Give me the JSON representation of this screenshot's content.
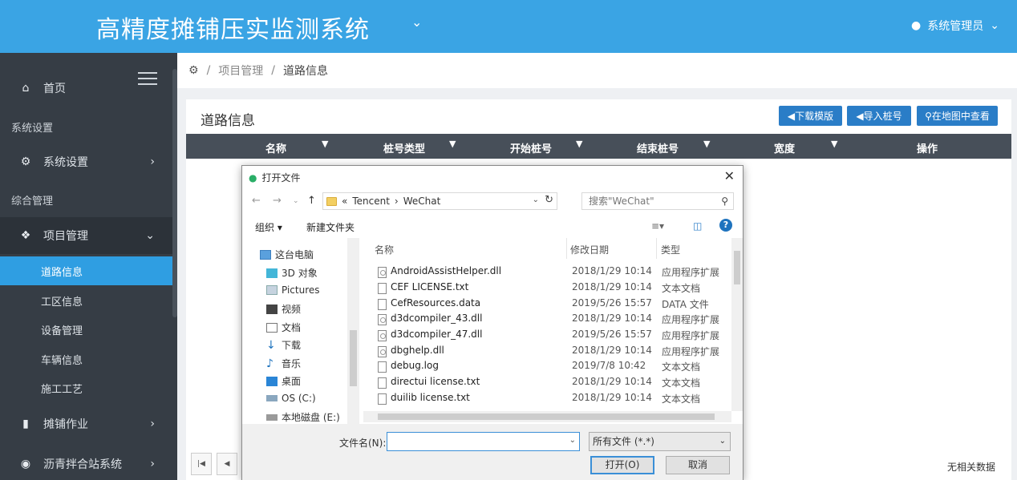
{
  "header": {
    "app_title": "高精度摊铺压实监测系统",
    "user_name": "系统管理员",
    "user_icon": "person-icon",
    "accent": "#3aa4e4"
  },
  "sidebar": {
    "home": "首页",
    "section_system": "系统设置",
    "system_settings": "系统设置",
    "section_general": "综合管理",
    "project_mgmt": "项目管理",
    "sub_items": [
      "道路信息",
      "工区信息",
      "设备管理",
      "车辆信息",
      "施工工艺"
    ],
    "active_sub": "道路信息",
    "paving": "摊铺作业",
    "asphalt": "沥青拌合站系统"
  },
  "breadcrumb": {
    "items": [
      "项目管理",
      "道路信息"
    ]
  },
  "panel": {
    "title": "道路信息",
    "btn_download": "下载模版",
    "btn_import": "导入桩号",
    "btn_map": "在地图中查看",
    "columns": [
      "名称",
      "桩号类型",
      "开始桩号",
      "结束桩号",
      "宽度",
      "操作"
    ],
    "no_data": "无相关数据"
  },
  "dialog": {
    "title": "打开文件",
    "path": [
      "«",
      "Tencent",
      "›",
      "WeChat"
    ],
    "search_placeholder": "搜索\"WeChat\"",
    "organize": "组织 ▾",
    "new_folder": "新建文件夹",
    "nav_items": [
      {
        "label": "这台电脑",
        "icon": "computer-icon"
      },
      {
        "label": "3D 对象",
        "icon": "cube-icon"
      },
      {
        "label": "Pictures",
        "icon": "pictures-icon"
      },
      {
        "label": "视频",
        "icon": "video-icon"
      },
      {
        "label": "文档",
        "icon": "document-icon"
      },
      {
        "label": "下载",
        "icon": "download-icon"
      },
      {
        "label": "音乐",
        "icon": "music-icon"
      },
      {
        "label": "桌面",
        "icon": "desktop-icon"
      },
      {
        "label": "OS (C:)",
        "icon": "drive-icon"
      },
      {
        "label": "本地磁盘 (E:)",
        "icon": "drive-icon"
      }
    ],
    "col_name": "名称",
    "col_date": "修改日期",
    "col_type": "类型",
    "files": [
      {
        "name": "AndroidAssistHelper.dll",
        "date": "2018/1/29 10:14",
        "type": "应用程序扩展",
        "kind": "dll"
      },
      {
        "name": "CEF LICENSE.txt",
        "date": "2018/1/29 10:14",
        "type": "文本文档",
        "kind": "txt"
      },
      {
        "name": "CefResources.data",
        "date": "2019/5/26 15:57",
        "type": "DATA 文件",
        "kind": "file"
      },
      {
        "name": "d3dcompiler_43.dll",
        "date": "2018/1/29 10:14",
        "type": "应用程序扩展",
        "kind": "dll"
      },
      {
        "name": "d3dcompiler_47.dll",
        "date": "2019/5/26 15:57",
        "type": "应用程序扩展",
        "kind": "dll"
      },
      {
        "name": "dbghelp.dll",
        "date": "2018/1/29 10:14",
        "type": "应用程序扩展",
        "kind": "dll"
      },
      {
        "name": "debug.log",
        "date": "2019/7/8 10:42",
        "type": "文本文档",
        "kind": "txt"
      },
      {
        "name": "directui license.txt",
        "date": "2018/1/29 10:14",
        "type": "文本文档",
        "kind": "txt"
      },
      {
        "name": "duilib license.txt",
        "date": "2018/1/29 10:14",
        "type": "文本文档",
        "kind": "txt"
      }
    ],
    "filename_label": "文件名(N):",
    "filename_value": "",
    "filetype": "所有文件 (*.*)",
    "open": "打开(O)",
    "cancel": "取消"
  }
}
